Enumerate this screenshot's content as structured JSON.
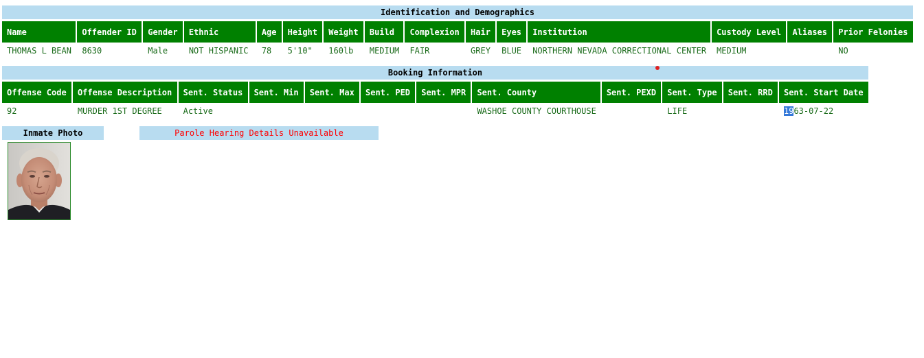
{
  "demographics": {
    "section_title": "Identification and Demographics",
    "headers": [
      "Name",
      "Offender ID",
      "Gender",
      "Ethnic",
      "Age",
      "Height",
      "Weight",
      "Build",
      "Complexion",
      "Hair",
      "Eyes",
      "Institution",
      "Custody Level",
      "Aliases",
      "Prior Felonies"
    ],
    "row": [
      "THOMAS L BEAN",
      "8630",
      "Male",
      "NOT HISPANIC",
      "78",
      "5'10\"",
      "160lb",
      "MEDIUM",
      "FAIR",
      "GREY",
      "BLUE",
      "NORTHERN NEVADA CORRECTIONAL CENTER",
      "MEDIUM",
      "",
      "NO"
    ]
  },
  "booking": {
    "section_title": "Booking Information",
    "headers": [
      "Offense Code",
      "Offense Description",
      "Sent. Status",
      "Sent. Min",
      "Sent. Max",
      "Sent. PED",
      "Sent. MPR",
      "Sent. County",
      "Sent. PEXD",
      "Sent. Type",
      "Sent. RRD",
      "Sent. Start Date"
    ],
    "row": [
      "92",
      "MURDER 1ST DEGREE",
      "Active",
      "",
      "",
      "",
      "",
      "WASHOE COUNTY COURTHOUSE",
      "",
      "LIFE",
      "",
      "1963-07-22"
    ],
    "start_date_selected": "19",
    "start_date_rest": "63-07-22"
  },
  "photo": {
    "title": "Inmate Photo"
  },
  "parole": {
    "message": "Parole Hearing Details Unavailable"
  },
  "colors": {
    "header_green": "#008000",
    "bar_blue": "#b8dcf0",
    "cell_text": "#1a6b1a",
    "alert_red": "#ff0000",
    "selection_blue": "#3478d8"
  }
}
